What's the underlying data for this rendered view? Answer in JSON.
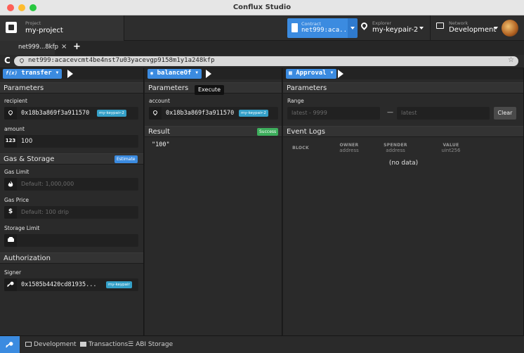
{
  "window": {
    "title": "Conflux Studio",
    "dot_colors": [
      "#fe5f57",
      "#febc2e",
      "#28c840"
    ]
  },
  "header": {
    "project": {
      "label": "Project",
      "value": "my-project"
    },
    "contract": {
      "label": "Contract",
      "value": "net999:aca..."
    },
    "explorer": {
      "label": "Explorer",
      "value": "my-keypair-2"
    },
    "network": {
      "label": "Network",
      "value": "Development"
    }
  },
  "tabs": [
    {
      "label": "net999...8kfp",
      "close": "×"
    }
  ],
  "tab_add": "+",
  "address": {
    "reload": "C",
    "value": "net999:acacevcmt4be4nst7u03yacevgp9158m1y1a248kfp",
    "star": "☆"
  },
  "panels": {
    "transfer": {
      "fn_icon": "f(x)",
      "fn_name": "transfer",
      "parameters_title": "Parameters",
      "recipient": {
        "label": "recipient",
        "value": "0x18b3a869f3a911570",
        "chip": "my-keypair-2"
      },
      "amount": {
        "label": "amount",
        "icon_text": "123",
        "value": "100"
      },
      "gas_title": "Gas & Storage",
      "estimate_label": "Estimate",
      "gas_limit": {
        "label": "Gas Limit",
        "placeholder": "Default: 1,000,000"
      },
      "gas_price": {
        "label": "Gas Price",
        "icon_text": "$",
        "placeholder": "Default: 100 drip"
      },
      "storage_limit": {
        "label": "Storage Limit",
        "placeholder": ""
      },
      "auth_title": "Authorization",
      "signer": {
        "label": "Signer",
        "value": "0x1585b4420cd81935...",
        "chip": "my-keypair"
      }
    },
    "balanceOf": {
      "fn_icon": "◉",
      "fn_name": "balanceOf",
      "parameters_title": "Parameters",
      "tooltip": "Execute",
      "account": {
        "label": "account",
        "value": "0x18b3a869f3a911570",
        "chip": "my-keypair-2"
      },
      "result_title": "Result",
      "status": "Success",
      "result_value": "\"100\""
    },
    "approval": {
      "fn_icon": "▦",
      "fn_name": "Approval",
      "parameters_title": "Parameters",
      "range": {
        "label": "Range",
        "from_placeholder": "latest - 9999",
        "sep": "—",
        "to_placeholder": "latest",
        "clear_label": "Clear"
      },
      "event_logs_title": "Event Logs",
      "columns": [
        {
          "name": "BLOCK",
          "type": ""
        },
        {
          "name": "OWNER",
          "type": "address"
        },
        {
          "name": "SPENDER",
          "type": "address"
        },
        {
          "name": "VALUE",
          "type": "uint256"
        }
      ],
      "empty_text": "(no data)"
    }
  },
  "statusbar": {
    "items": [
      {
        "label": "Development"
      },
      {
        "label": "Transactions"
      },
      {
        "label": "ABI Storage"
      }
    ]
  },
  "colors": {
    "accent": "#3b8be0",
    "success": "#3dae5c",
    "chip": "#34a0c8"
  }
}
